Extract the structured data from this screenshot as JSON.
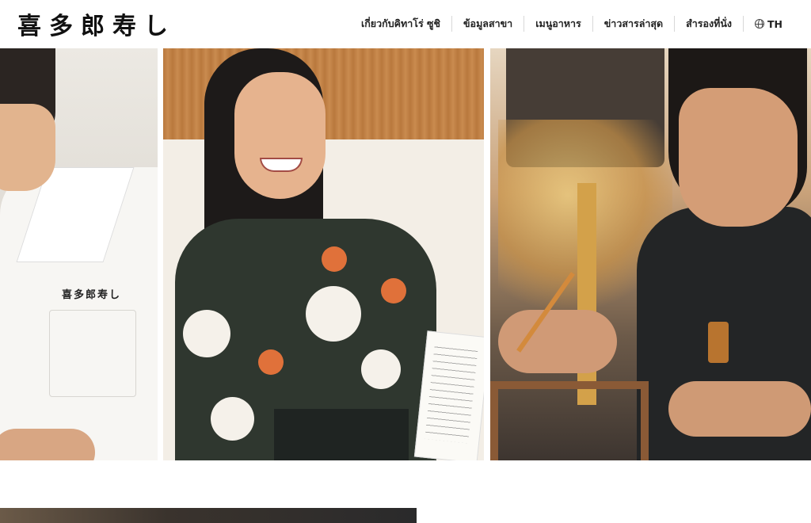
{
  "header": {
    "logo_text": "喜多郎寿し",
    "nav": [
      {
        "label": "เกี่ยวกับคิทาโร่ ซูชิ"
      },
      {
        "label": "ข้อมูลสาขา"
      },
      {
        "label": "เมนูอาหาร"
      },
      {
        "label": "ข่าวสารล่าสุด"
      },
      {
        "label": "สำรองที่นั่ง"
      }
    ],
    "language": {
      "label": "TH",
      "icon": "globe-icon"
    }
  },
  "photos": {
    "panel1": {
      "embroidery": "喜多郎寿し"
    }
  }
}
